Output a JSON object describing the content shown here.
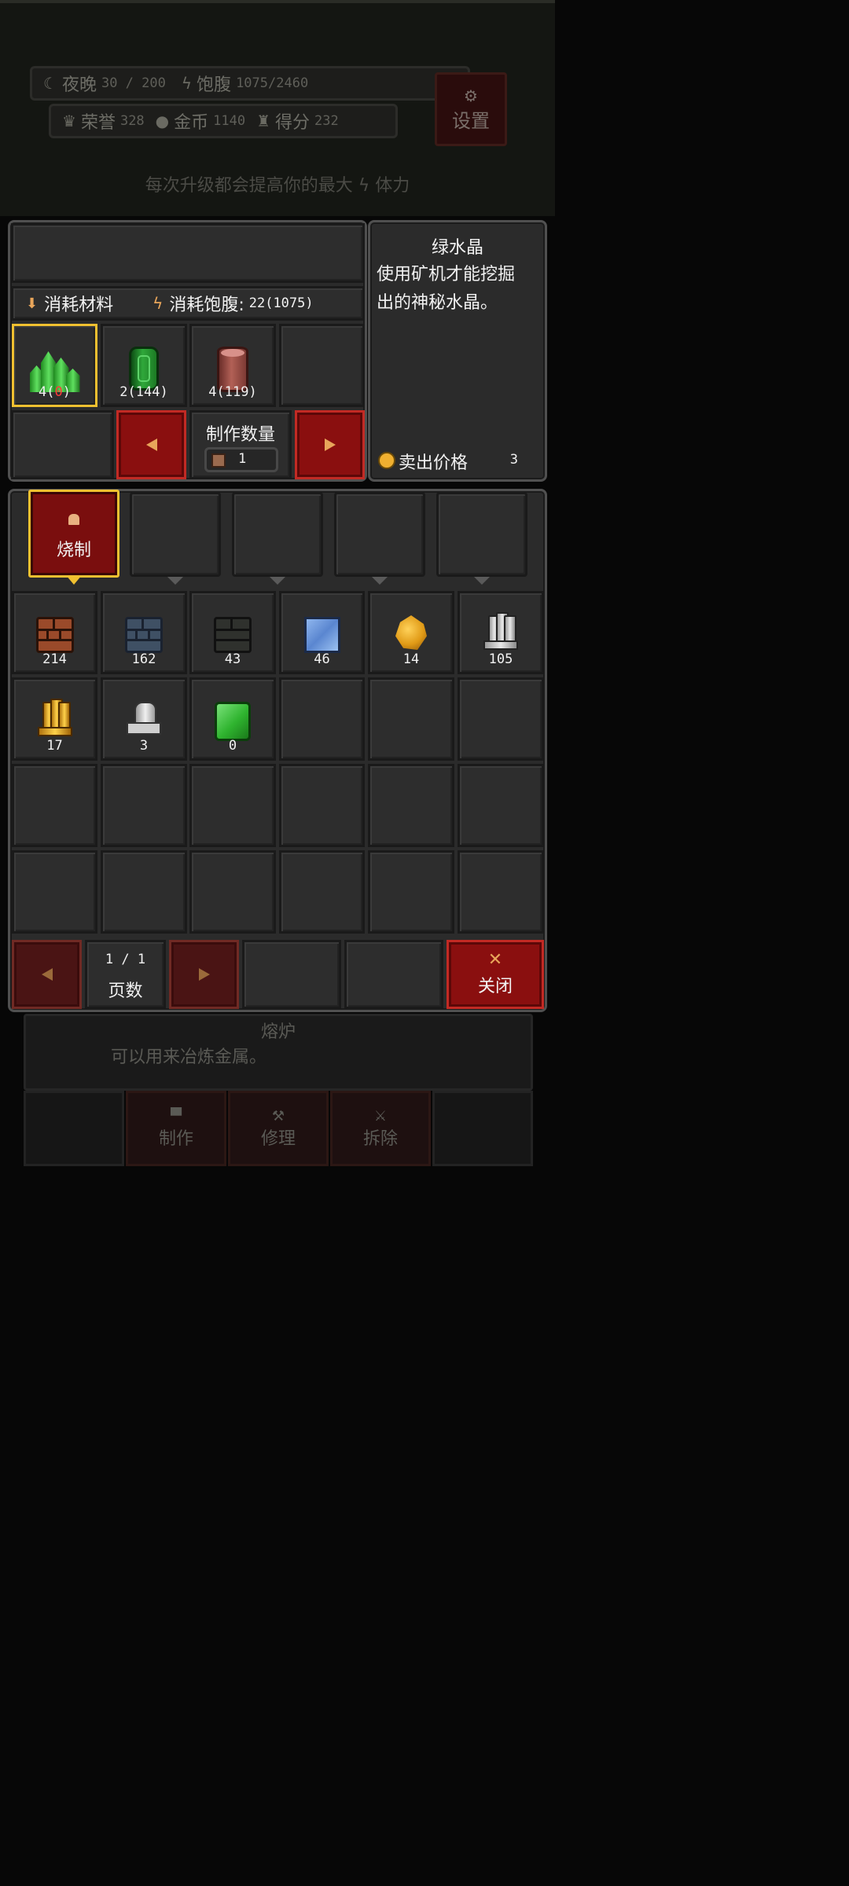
{
  "hud": {
    "night_label": "夜晚",
    "night_value": "30 / 200",
    "satiety_label": "饱腹",
    "satiety_value": "1075/2460",
    "honor_label": "荣誉",
    "honor_value": "328",
    "gold_label": "金币",
    "gold_value": "1140",
    "score_label": "得分",
    "score_value": "232",
    "settings_label": "设置",
    "tip_part1": "每次升级都会提高你的最大",
    "tip_part2": "体力"
  },
  "recipe": {
    "materials_label": "消耗材料",
    "satiety_cost_label": "消耗饱腹:",
    "satiety_cost_value": "22(1075)",
    "ingredients": [
      {
        "icon": "green-crystal-icon",
        "need": "4(",
        "have": "0",
        "close": ")",
        "have_color": "#ff3a3a"
      },
      {
        "icon": "emerald-icon",
        "count": "2(144)"
      },
      {
        "icon": "wood-log-icon",
        "count": "4(119)"
      }
    ],
    "quantity_label": "制作数量",
    "quantity_value": "1"
  },
  "detail": {
    "name": "绿水晶",
    "desc_line1": "使用矿机才能挖掘",
    "desc_line2": "出的神秘水晶。",
    "sell_label": "卖出价格",
    "sell_value": "3"
  },
  "categories": {
    "active_label": "烧制"
  },
  "inventory": [
    {
      "icon": "red-brick-icon",
      "count": "214"
    },
    {
      "icon": "blue-brick-icon",
      "count": "162"
    },
    {
      "icon": "dark-brick-icon",
      "count": "43"
    },
    {
      "icon": "glass-block-icon",
      "count": "46"
    },
    {
      "icon": "gold-ore-icon",
      "count": "14"
    },
    {
      "icon": "silver-ingot-icon",
      "count": "105"
    },
    {
      "icon": "gold-ingot-icon",
      "count": "17"
    },
    {
      "icon": "metal-machine-icon",
      "count": "3"
    },
    {
      "icon": "green-cube-icon",
      "count": "0"
    }
  ],
  "pager": {
    "page_value": "1 / 1",
    "page_label": "页数",
    "close_label": "关闭"
  },
  "background_panel": {
    "furnace_title": "熔炉",
    "furnace_desc": "可以用来冶炼金属。",
    "craft_label": "制作",
    "repair_label": "修理",
    "dismantle_label": "拆除"
  },
  "colors": {
    "accent_gold": "#f0c030",
    "button_red": "#8a0f0f",
    "panel_grey": "#2b2b2b"
  }
}
